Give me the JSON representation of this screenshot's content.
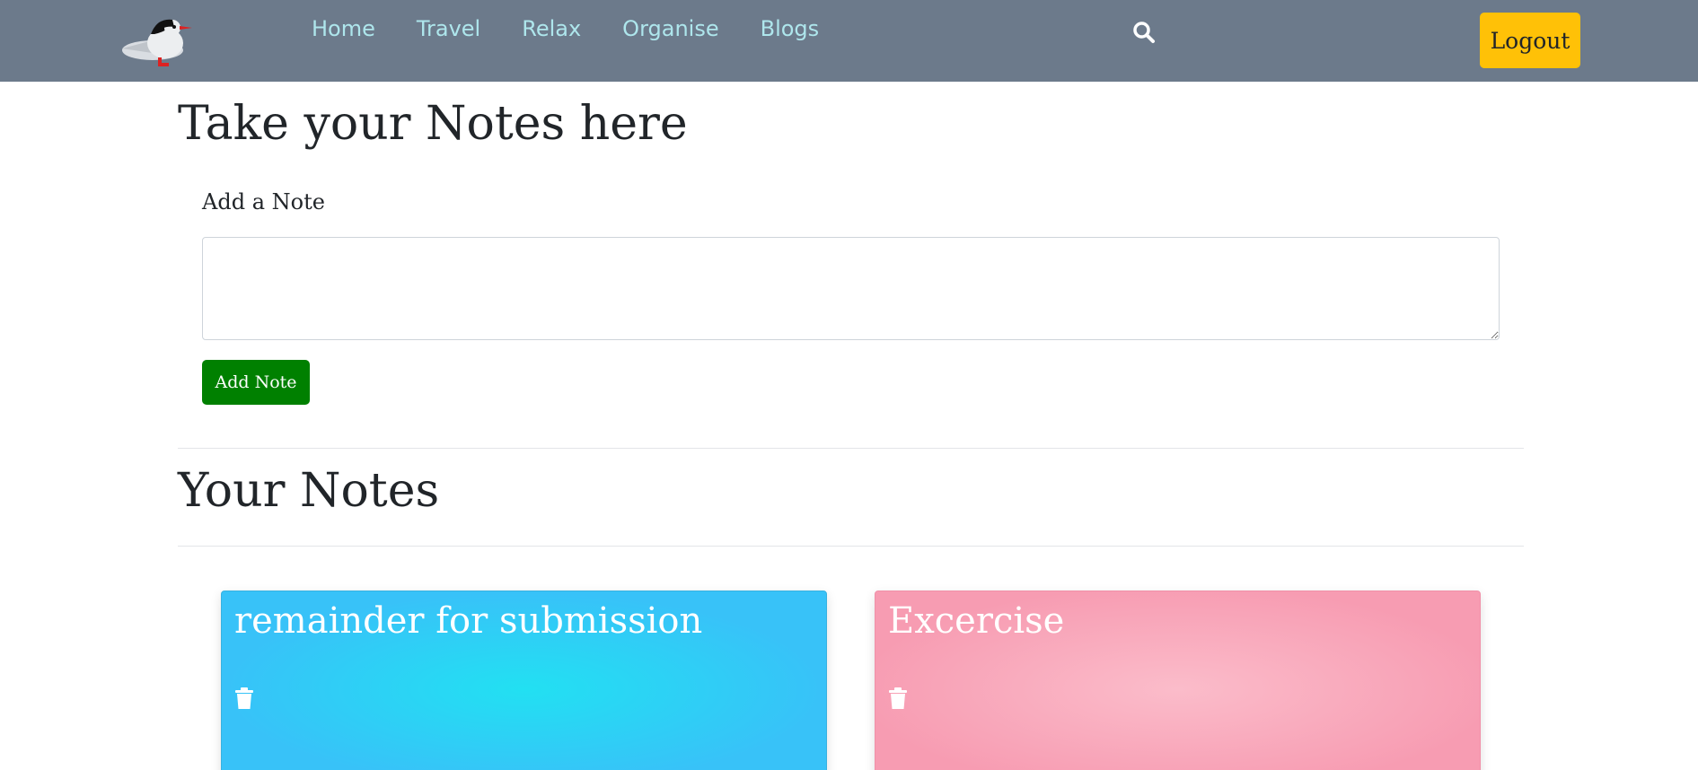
{
  "nav": {
    "links": [
      {
        "label": "Home"
      },
      {
        "label": "Travel"
      },
      {
        "label": "Relax"
      },
      {
        "label": "Organise"
      },
      {
        "label": "Blogs"
      }
    ],
    "search_icon": "search-icon",
    "logout_label": "Logout",
    "colors": {
      "bar": "#6c7a8b",
      "link": "#aee6ec",
      "logout": "#ffc107"
    }
  },
  "form": {
    "page_title": "Take your Notes here",
    "label": "Add a Note",
    "textarea_value": "",
    "submit_label": "Add Note",
    "submit_color": "#008000"
  },
  "notes_section": {
    "title": "Your Notes",
    "notes": [
      {
        "title": "remainder for submission",
        "color": "#38c2f8",
        "icon": "trash-icon"
      },
      {
        "title": "Excercise",
        "color": "#f79cb2",
        "icon": "trash-icon"
      }
    ]
  }
}
